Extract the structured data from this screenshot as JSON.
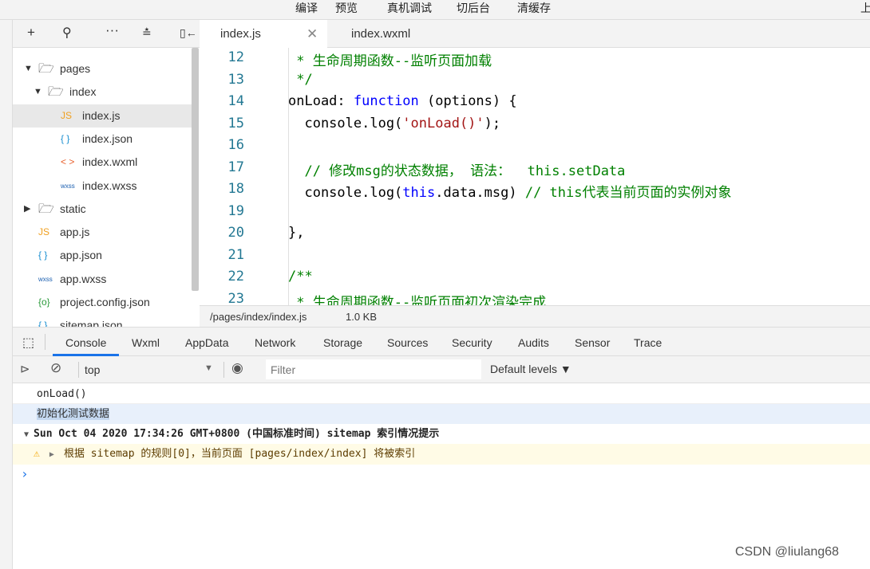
{
  "topbar": {
    "items": [
      "编译",
      "预览",
      "真机调试",
      "切后台",
      "清缓存"
    ],
    "edge": "上"
  },
  "sidebar": {
    "tools": [
      "+",
      "search-icon",
      "more-icon",
      "collapse-icon",
      "split-icon"
    ],
    "items": [
      {
        "label": "pages",
        "icon": "folder",
        "depth": 0,
        "arrow": "▼"
      },
      {
        "label": "index",
        "icon": "folder",
        "depth": 1,
        "arrow": "▼"
      },
      {
        "label": "index.js",
        "icon": "JS",
        "depth": 2,
        "selected": true
      },
      {
        "label": "index.json",
        "icon": "{ }",
        "depth": 2
      },
      {
        "label": "index.wxml",
        "icon": "< >",
        "depth": 2
      },
      {
        "label": "index.wxss",
        "icon": "wxss",
        "depth": 2
      },
      {
        "label": "static",
        "icon": "folder",
        "depth": 0,
        "arrow": "▶"
      },
      {
        "label": "app.js",
        "icon": "JS",
        "depth": 1
      },
      {
        "label": "app.json",
        "icon": "{ }",
        "depth": 1
      },
      {
        "label": "app.wxss",
        "icon": "wxss",
        "depth": 1
      },
      {
        "label": "project.config.json",
        "icon": "{o}",
        "depth": 1
      },
      {
        "label": "sitemap.json",
        "icon": "{ }",
        "depth": 1
      }
    ]
  },
  "editor": {
    "tabs": [
      {
        "label": "index.js",
        "active": true
      },
      {
        "label": "index.wxml"
      }
    ],
    "lines": [
      {
        "n": "12",
        "parts": [
          [
            "cm",
            " * 生命周期函数--监听页面加载"
          ]
        ]
      },
      {
        "n": "13",
        "parts": [
          [
            "cm",
            " */"
          ]
        ]
      },
      {
        "n": "14",
        "parts": [
          [
            "",
            "onLoad: "
          ],
          [
            "kw",
            "function"
          ],
          [
            "",
            " (options) {"
          ]
        ]
      },
      {
        "n": "15",
        "parts": [
          [
            "",
            "  console.log("
          ],
          [
            "st",
            "'onLoad()'"
          ],
          [
            "",
            ");"
          ]
        ]
      },
      {
        "n": "16",
        "parts": []
      },
      {
        "n": "17",
        "parts": [
          [
            "cm",
            "  // 修改msg的状态数据， 语法：  this.setData"
          ]
        ]
      },
      {
        "n": "18",
        "parts": [
          [
            "",
            "  console.log("
          ],
          [
            "kw",
            "this"
          ],
          [
            "",
            ".data.msg) "
          ],
          [
            "cm",
            "// this代表当前页面的实例对象"
          ]
        ]
      },
      {
        "n": "19",
        "parts": []
      },
      {
        "n": "20",
        "parts": [
          [
            "",
            "},"
          ]
        ]
      },
      {
        "n": "21",
        "parts": []
      },
      {
        "n": "22",
        "parts": [
          [
            "cm",
            "/**"
          ]
        ]
      },
      {
        "n": "23",
        "parts": [
          [
            "cm",
            " * 生命周期函数--监听页面初次渲染完成"
          ]
        ]
      }
    ]
  },
  "status": {
    "path": "/pages/index/index.js",
    "size": "1.0 KB"
  },
  "devtools": {
    "tabs": [
      "Console",
      "Wxml",
      "AppData",
      "Network",
      "Storage",
      "Sources",
      "Security",
      "Audits",
      "Sensor",
      "Trace"
    ],
    "active": "Console",
    "context": "top",
    "filter_placeholder": "Filter",
    "levels": "Default levels ▼"
  },
  "console": {
    "log1": "onLoad()",
    "log2": "初始化测试数据",
    "group": "Sun Oct 04 2020 17:34:26 GMT+0800 (中国标准时间) sitemap 索引情况提示",
    "warning": "根据 sitemap 的规则[0]，当前页面 [pages/index/index] 将被索引",
    "prompt": "›"
  },
  "watermark": "CSDN @liulang68",
  "colors": {
    "accent": "#1a73e8",
    "warning_bg": "#fffbe6",
    "selected_bg": "#e8f0fb"
  }
}
